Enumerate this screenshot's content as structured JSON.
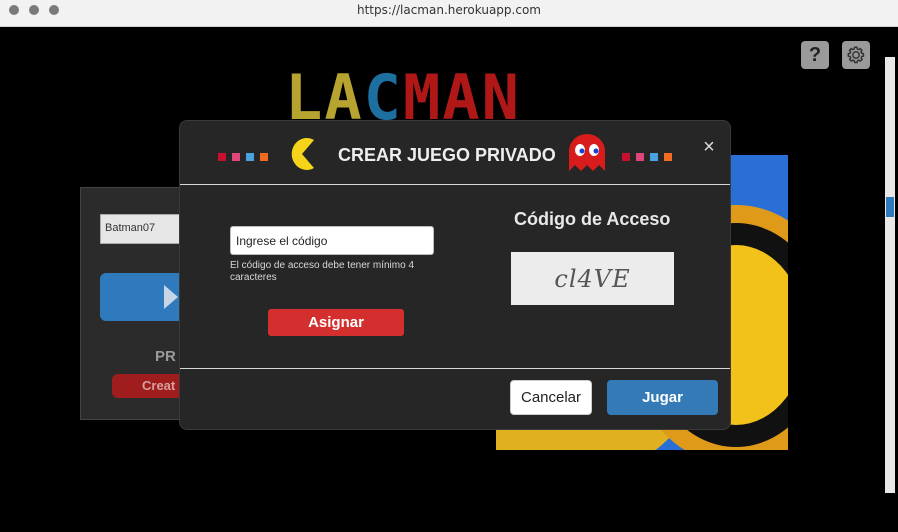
{
  "browser": {
    "url": "https://lacman.herokuapp.com"
  },
  "header": {
    "help_label": "?",
    "logo": {
      "part1": "LA",
      "part2": "C",
      "part3": "MAN"
    }
  },
  "background": {
    "username_value": "Batman07",
    "private_label": "PR",
    "create_label": "Creat"
  },
  "modal": {
    "title": "CREAR JUEGO PRIVADO",
    "close_label": "×",
    "code_input_placeholder": "Ingrese el código",
    "code_help_text": "El código de acceso debe tener mínimo 4 caracteres",
    "assign_label": "Asignar",
    "access_title": "Código de Acceso",
    "captcha_text": "cl4VE",
    "cancel_label": "Cancelar",
    "play_label": "Jugar"
  },
  "colors": {
    "square_red": "#c8102e",
    "square_pink": "#e0457b",
    "square_blue": "#4aa3df",
    "square_orange": "#f26b21",
    "pacman_yellow": "#f5d419",
    "ghost_red": "#d81b1b",
    "accent_blue": "#337ab7",
    "assign_red": "#d32f2f"
  }
}
